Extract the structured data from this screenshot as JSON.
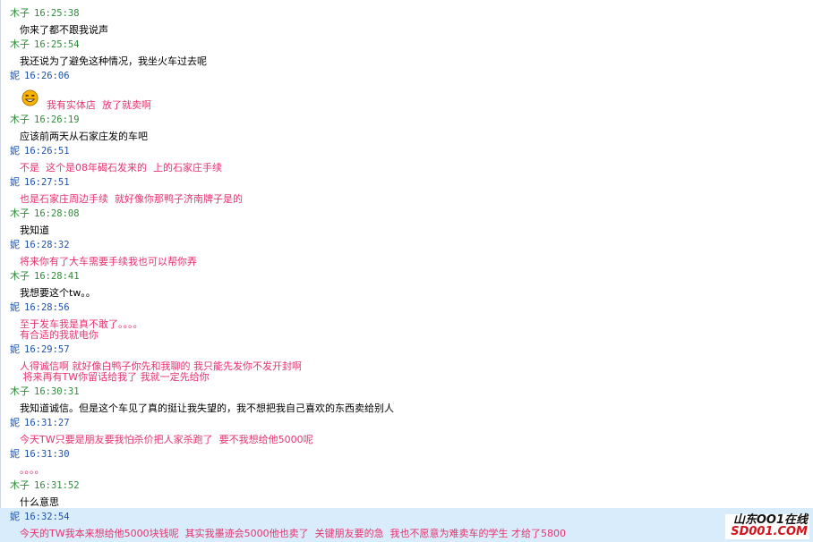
{
  "messages": [
    {
      "sender": "木子",
      "time": "16:25:38",
      "lines": [
        "你来了都不跟我说声"
      ]
    },
    {
      "sender": "木子",
      "time": "16:25:54",
      "lines": [
        "我还说为了避免这种情况，我坐火车过去呢"
      ]
    },
    {
      "sender": "妮",
      "time": "16:26:06",
      "emoji": "grinning-face-emoji",
      "lines": [
        "我有实体店  放了就卖啊"
      ]
    },
    {
      "sender": "木子",
      "time": "16:26:19",
      "lines": [
        "应该前两天从石家庄发的车吧"
      ]
    },
    {
      "sender": "妮",
      "time": "16:26:51",
      "lines": [
        "不是  这个是08年碣石发来的  上的石家庄手续"
      ]
    },
    {
      "sender": "妮",
      "time": "16:27:51",
      "lines": [
        "也是石家庄周边手续  就好像你那鸭子济南牌子是的"
      ]
    },
    {
      "sender": "木子",
      "time": "16:28:08",
      "lines": [
        "我知道"
      ]
    },
    {
      "sender": "妮",
      "time": "16:28:32",
      "lines": [
        "将来你有了大车需要手续我也可以帮你弄"
      ]
    },
    {
      "sender": "木子",
      "time": "16:28:41",
      "lines": [
        "我想要这个tw。。"
      ]
    },
    {
      "sender": "妮",
      "time": "16:28:56",
      "lines": [
        "至于发车我是真不敢了。。。。",
        "有合适的我就电你"
      ]
    },
    {
      "sender": "妮",
      "time": "16:29:57",
      "lines": [
        "人得诚信啊 就好像白鸭子你先和我聊的 我只能先发你不发开封啊",
        " 将来再有TW你留话给我了 我就一定先给你"
      ]
    },
    {
      "sender": "木子",
      "time": "16:30:31",
      "lines": [
        "我知道诚信。但是这个车见了真的挺让我失望的，我不想把我自己喜欢的东西卖给别人"
      ]
    },
    {
      "sender": "妮",
      "time": "16:31:27",
      "lines": [
        "今天TW只要是朋友要我怕杀价把人家杀跑了  要不我想给他5000呢"
      ]
    },
    {
      "sender": "妮",
      "time": "16:31:30",
      "lines": [
        "。。。。"
      ]
    },
    {
      "sender": "木子",
      "time": "16:31:52",
      "lines": [
        "什么意思"
      ]
    },
    {
      "sender": "妮",
      "time": "16:32:54",
      "lines": [
        "今天的TW我本来想给他5000块钱呢  其实我墨迹会5000他也卖了  关键朋友要的急  我也不愿意为难卖车的学生 才给了5800"
      ]
    }
  ],
  "watermark": {
    "line1": "山东OO1在线",
    "line2": "SD001.COM"
  },
  "colors": {
    "me_name": "#2e8b3a",
    "other_name": "#1f52a8",
    "other_text": "#e8336e",
    "me_text": "#000000",
    "highlight": "#d9ecfb"
  }
}
